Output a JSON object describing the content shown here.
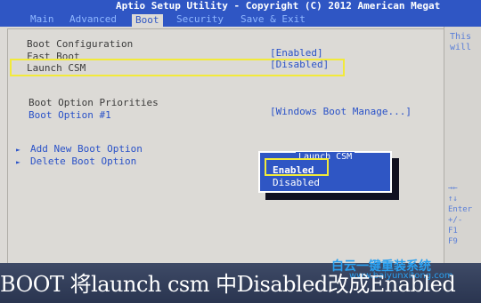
{
  "title": "Aptio Setup Utility - Copyright (C) 2012 American Megat",
  "tabs": [
    {
      "label": "Main"
    },
    {
      "label": "Advanced"
    },
    {
      "label": "Boot"
    },
    {
      "label": "Security"
    },
    {
      "label": "Save & Exit"
    }
  ],
  "boot": {
    "section_title": "Boot Configuration",
    "fast_boot_label": "Fast Boot",
    "fast_boot_value": "[Enabled]",
    "launch_csm_label": "Launch CSM",
    "launch_csm_value": "[Disabled]",
    "priorities_title": "Boot Option Priorities",
    "boot_option1_label": "Boot Option #1",
    "boot_option1_value": "[Windows Boot Manage...]",
    "add_option_label": "Add New Boot Option",
    "delete_option_label": "Delete Boot Option"
  },
  "help": {
    "text_line1": "This",
    "text_line2": "will",
    "keys": [
      "→←",
      "↑↓",
      "Enter",
      "+/-",
      "F1",
      "F9"
    ]
  },
  "popup": {
    "title": "Launch CSM",
    "options": [
      "Enabled",
      "Disabled"
    ],
    "selected": "Enabled"
  },
  "caption": "BOOT 将launch csm 中Disabled改成Enabled",
  "watermark": {
    "name": "白云一键重装系统",
    "url": "www.baiyunxitong.com"
  },
  "colors": {
    "header_blue": "#2f56c4",
    "panel_grey": "#dcdad6",
    "highlight_yellow": "#f2ea3a",
    "value_blue": "#2a52c8"
  }
}
